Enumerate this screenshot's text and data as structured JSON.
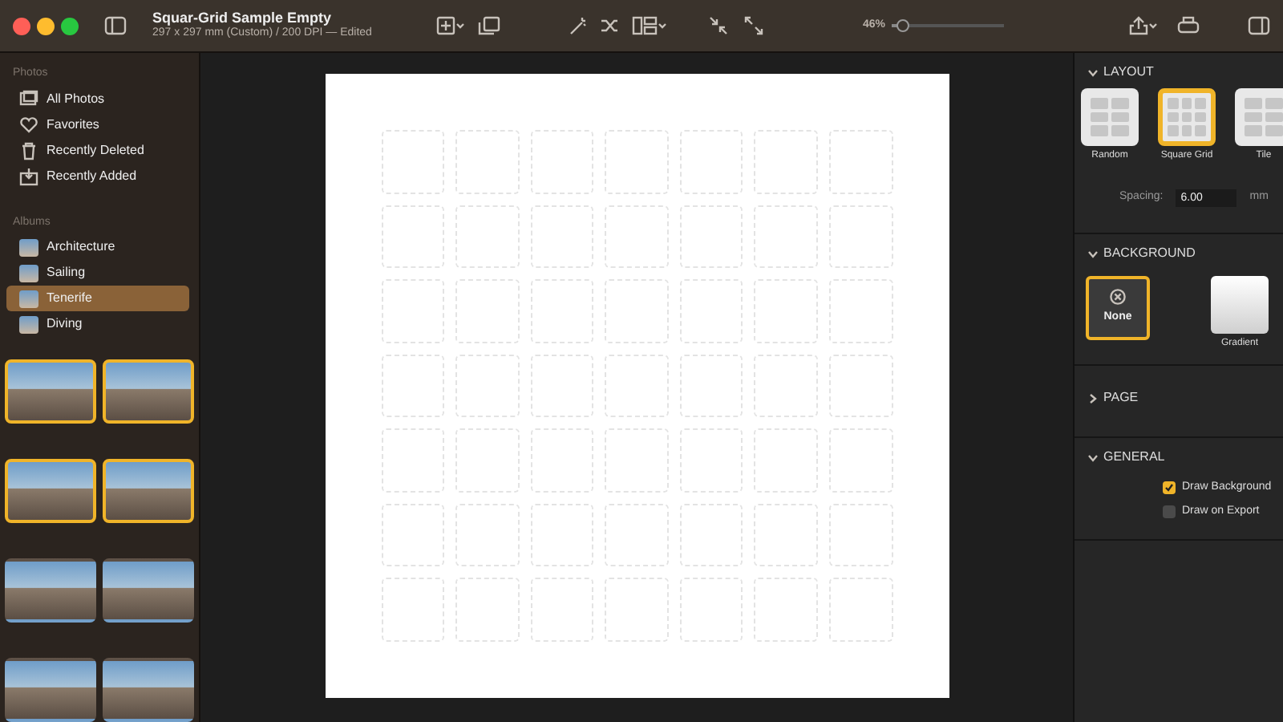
{
  "window": {
    "title": "Squar-Grid Sample Empty",
    "subtitle": "297 x 297 mm (Custom) / 200 DPI — Edited"
  },
  "toolbar": {
    "zoom": {
      "reading": "46%",
      "level": 0.1
    }
  },
  "sidebar": {
    "sections": [
      {
        "heading": "Photos",
        "items": [
          {
            "label": "All Photos",
            "selected": false
          },
          {
            "label": "Favorites",
            "selected": false
          },
          {
            "label": "Recently Deleted",
            "selected": false
          },
          {
            "label": "Recently Added",
            "selected": false
          }
        ]
      },
      {
        "heading": "Albums",
        "items": [
          {
            "label": "Architecture",
            "selected": false
          },
          {
            "label": "Sailing",
            "selected": false
          },
          {
            "label": "Tenerife",
            "selected": true
          },
          {
            "label": "Diving",
            "selected": false
          }
        ]
      }
    ],
    "thumbnails": [
      {
        "selected": true
      },
      {
        "selected": true
      },
      {
        "selected": true
      },
      {
        "selected": true
      },
      {
        "selected": false
      },
      {
        "selected": false
      },
      {
        "selected": false
      },
      {
        "selected": false
      }
    ]
  },
  "inspector": {
    "sections": [
      {
        "kind": "layout",
        "title": "LAYOUT",
        "expanded": true,
        "options": [
          {
            "label": "Random",
            "selected": false
          },
          {
            "label": "Square Grid",
            "selected": true
          },
          {
            "label": "Tile",
            "selected": false
          }
        ],
        "spacing": {
          "label": "Spacing:",
          "value": "6.00",
          "unit": "mm"
        }
      },
      {
        "kind": "background",
        "title": "BACKGROUND",
        "expanded": true,
        "options": [
          {
            "kind": "none",
            "label": "None",
            "selected": true
          },
          {
            "kind": "gradient",
            "label": "Gradient",
            "selected": false
          }
        ]
      },
      {
        "kind": "page",
        "title": "PAGE",
        "expanded": false
      },
      {
        "kind": "general",
        "title": "GENERAL",
        "expanded": true,
        "checkboxes": [
          {
            "label": "Draw Background",
            "checked": true
          },
          {
            "label": "Draw on Export",
            "checked": false
          }
        ]
      }
    ]
  }
}
